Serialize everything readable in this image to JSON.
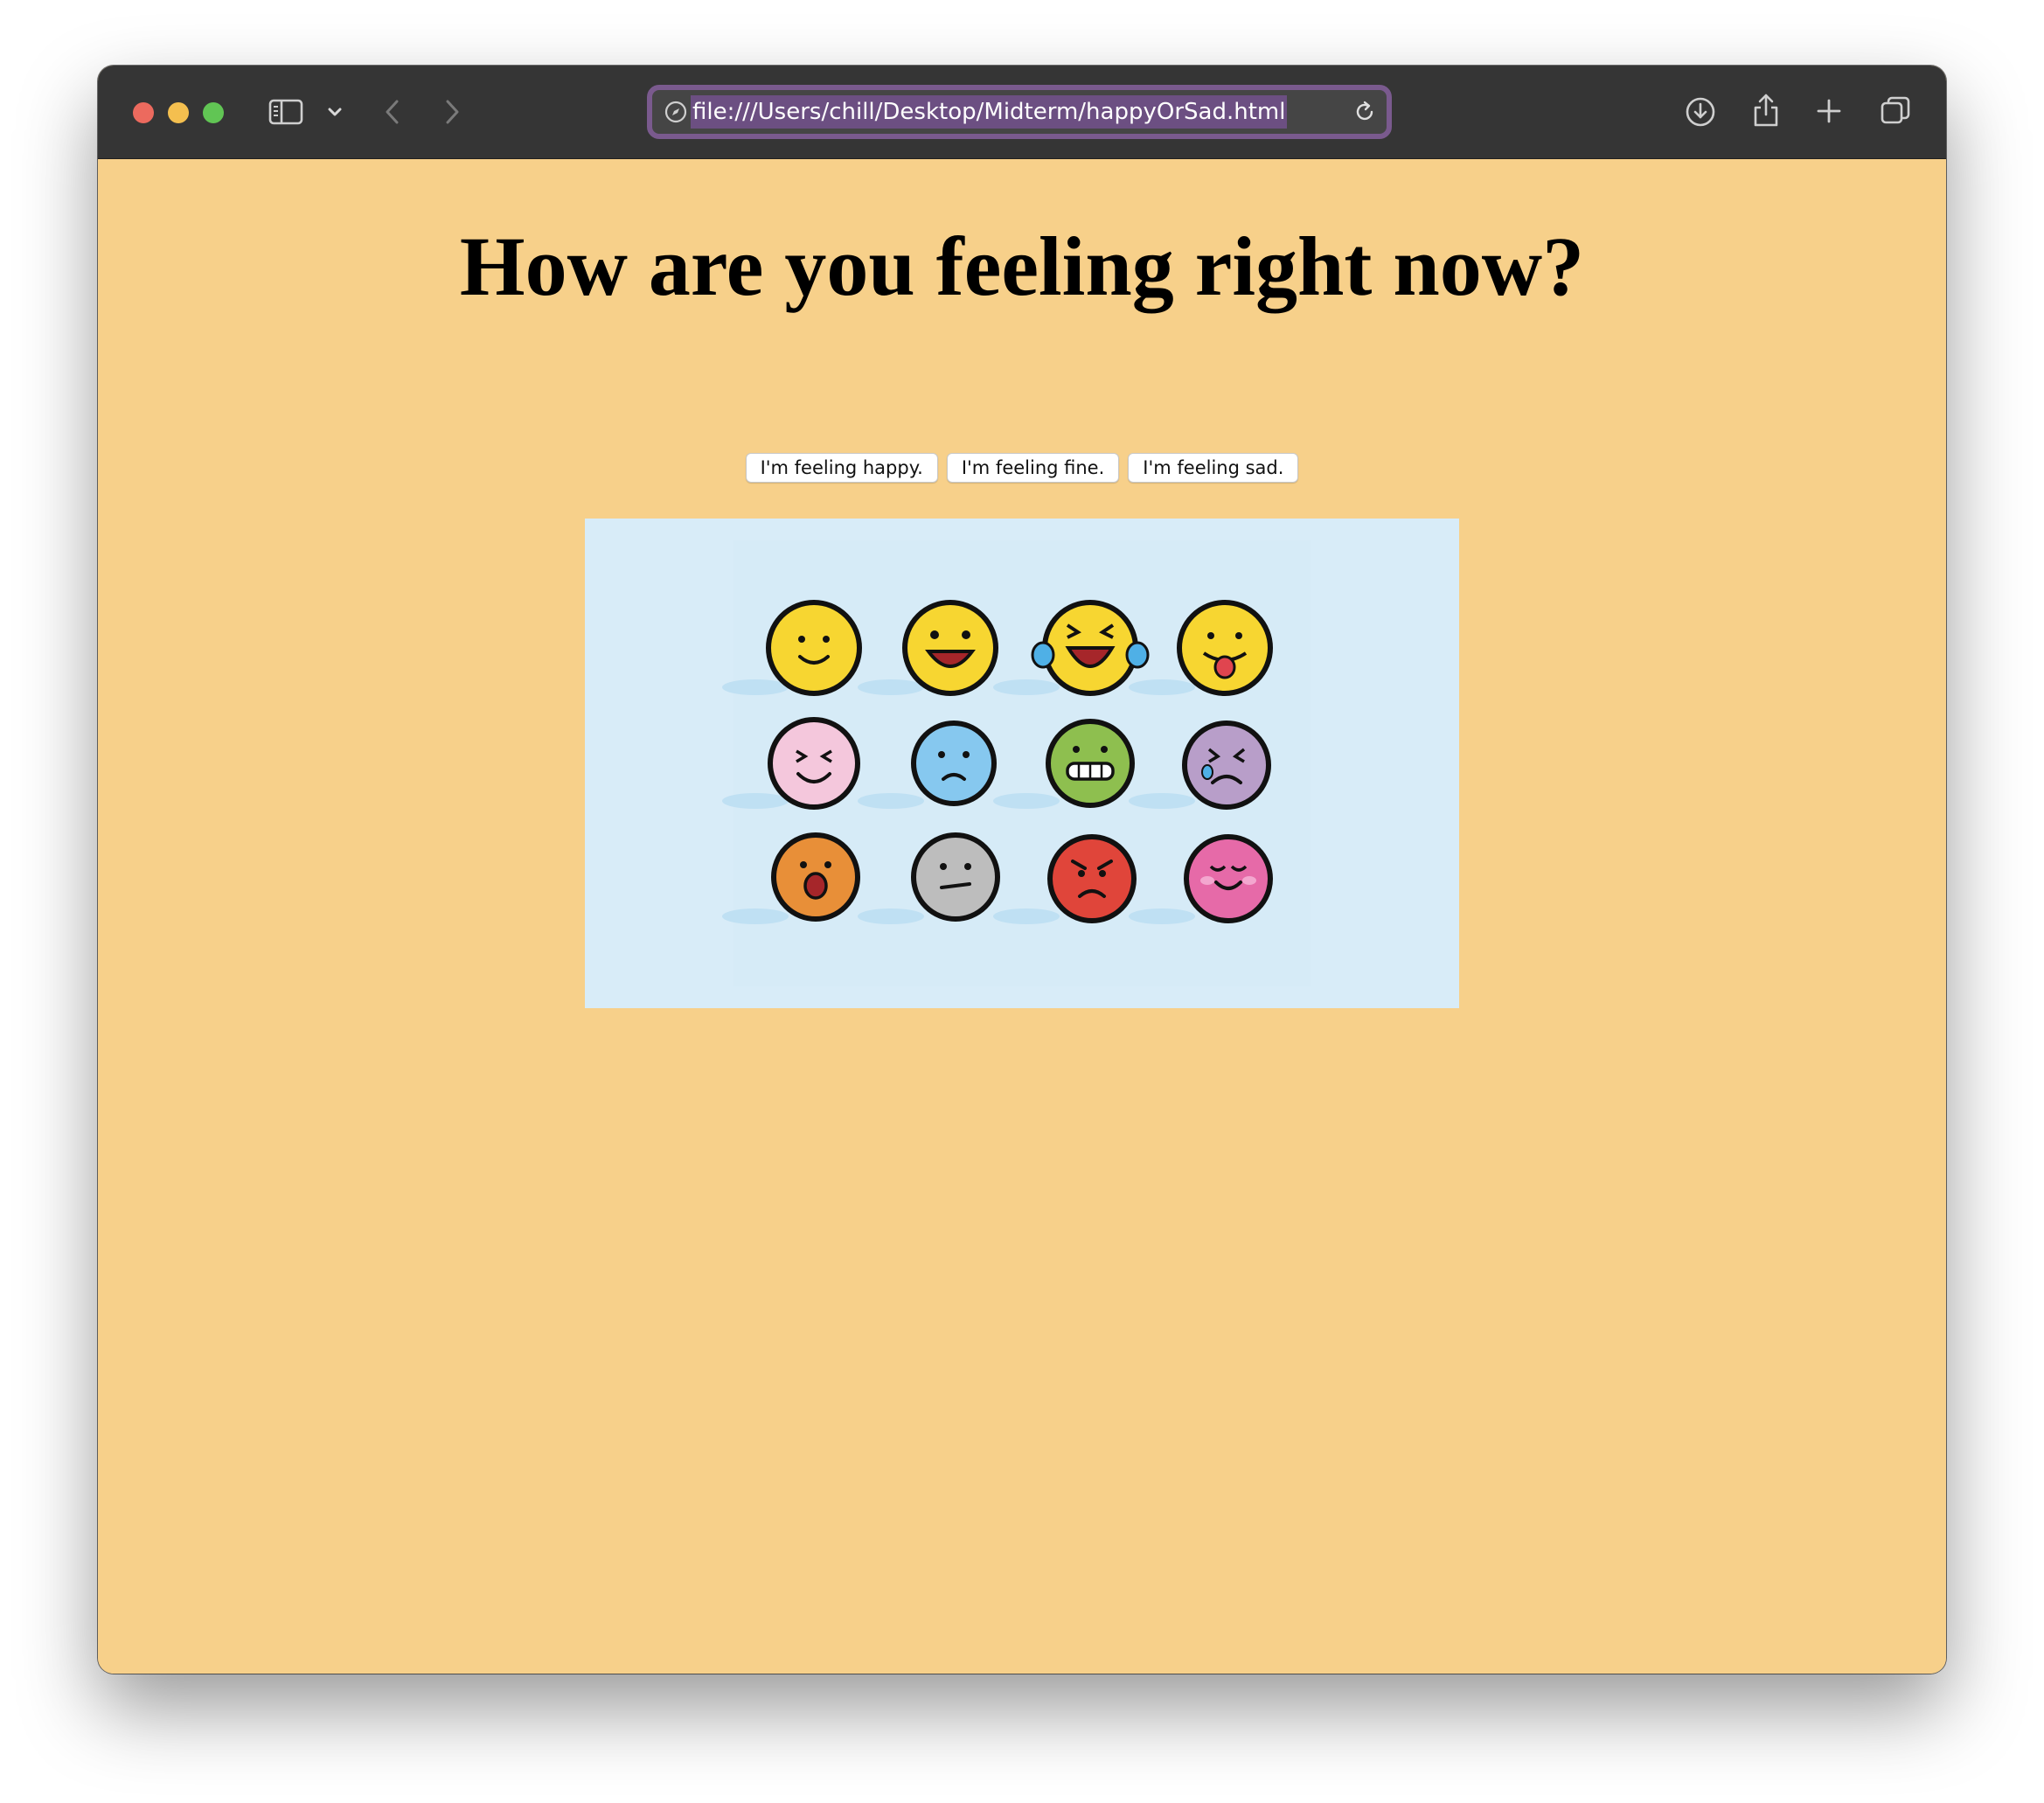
{
  "browser": {
    "url": "file:///Users/chill/Desktop/Midterm/happyOrSad.html",
    "traffic_lights": {
      "close": "#ec6a5e",
      "minimize": "#f4bf4f",
      "zoom": "#61c554"
    },
    "icons": [
      "sidebar-icon",
      "chevron-down-icon",
      "back-icon",
      "forward-icon",
      "site-compass-icon",
      "reload-icon",
      "download-icon",
      "share-icon",
      "new-tab-icon",
      "tab-overview-icon"
    ]
  },
  "page": {
    "background": "#f7d08a",
    "title": "How are you feeling right now?",
    "buttons": [
      {
        "label": "I'm feeling happy."
      },
      {
        "label": "I'm feeling fine."
      },
      {
        "label": "I'm feeling sad."
      }
    ],
    "image": {
      "background": "#d8ecf8",
      "emojis": [
        {
          "name": "smiling",
          "color": "#f7d631"
        },
        {
          "name": "grinning",
          "color": "#f7d631"
        },
        {
          "name": "tears-of-joy",
          "color": "#f7d631"
        },
        {
          "name": "tongue-out",
          "color": "#f7d631"
        },
        {
          "name": "wincing-smile",
          "color": "#f4c7dc"
        },
        {
          "name": "frowning",
          "color": "#86c8ef"
        },
        {
          "name": "grimacing",
          "color": "#8ebf4f"
        },
        {
          "name": "crying",
          "color": "#b89ec9"
        },
        {
          "name": "shocked",
          "color": "#e88f38"
        },
        {
          "name": "neutral",
          "color": "#bdbdbd"
        },
        {
          "name": "angry",
          "color": "#e0453a"
        },
        {
          "name": "blushing",
          "color": "#e66aa8"
        }
      ]
    }
  }
}
